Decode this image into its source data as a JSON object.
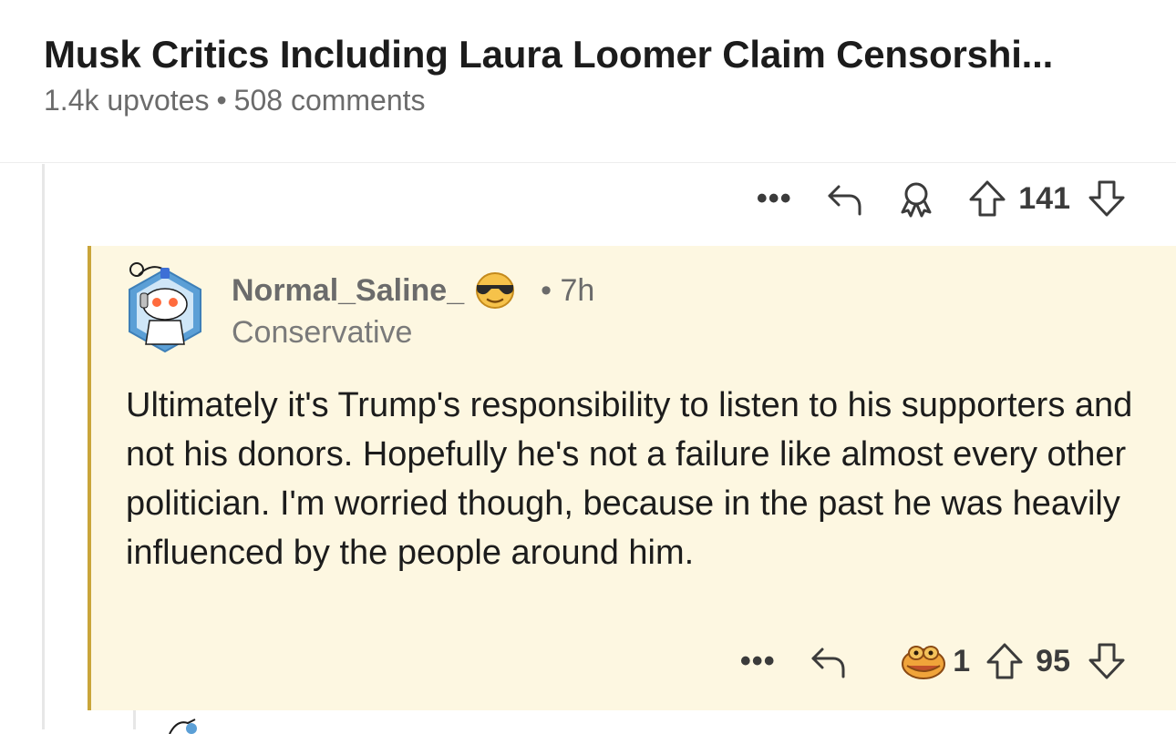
{
  "post": {
    "title": "Musk Critics Including Laura Loomer Claim Censorshi...",
    "upvotes": "1.4k upvotes",
    "separator": "•",
    "comments": "508 comments"
  },
  "parent_actions": {
    "more_label": "•••",
    "vote_count": "141"
  },
  "comment": {
    "username": "Normal_Saline_",
    "time": "• 7h",
    "flair": "Conservative",
    "body": "Ultimately it's Trump's responsibility to listen to his supporters and not his donors. Hopefully he's not a failure like almost every other politician. I'm worried though, because in the past he was heavily influenced by the people around him.",
    "actions": {
      "more_label": "•••",
      "award_count": "1",
      "vote_count": "95"
    }
  },
  "colors": {
    "comment_highlight": "#fdf7e1",
    "comment_bar": "#c9a53a",
    "meta_text": "#6b6b6b"
  },
  "icons": [
    "more-icon",
    "reply-icon",
    "award-icon",
    "upvote-icon",
    "downvote-icon",
    "sunglasses-emoji-icon",
    "goldfish-award-icon",
    "avatar"
  ]
}
